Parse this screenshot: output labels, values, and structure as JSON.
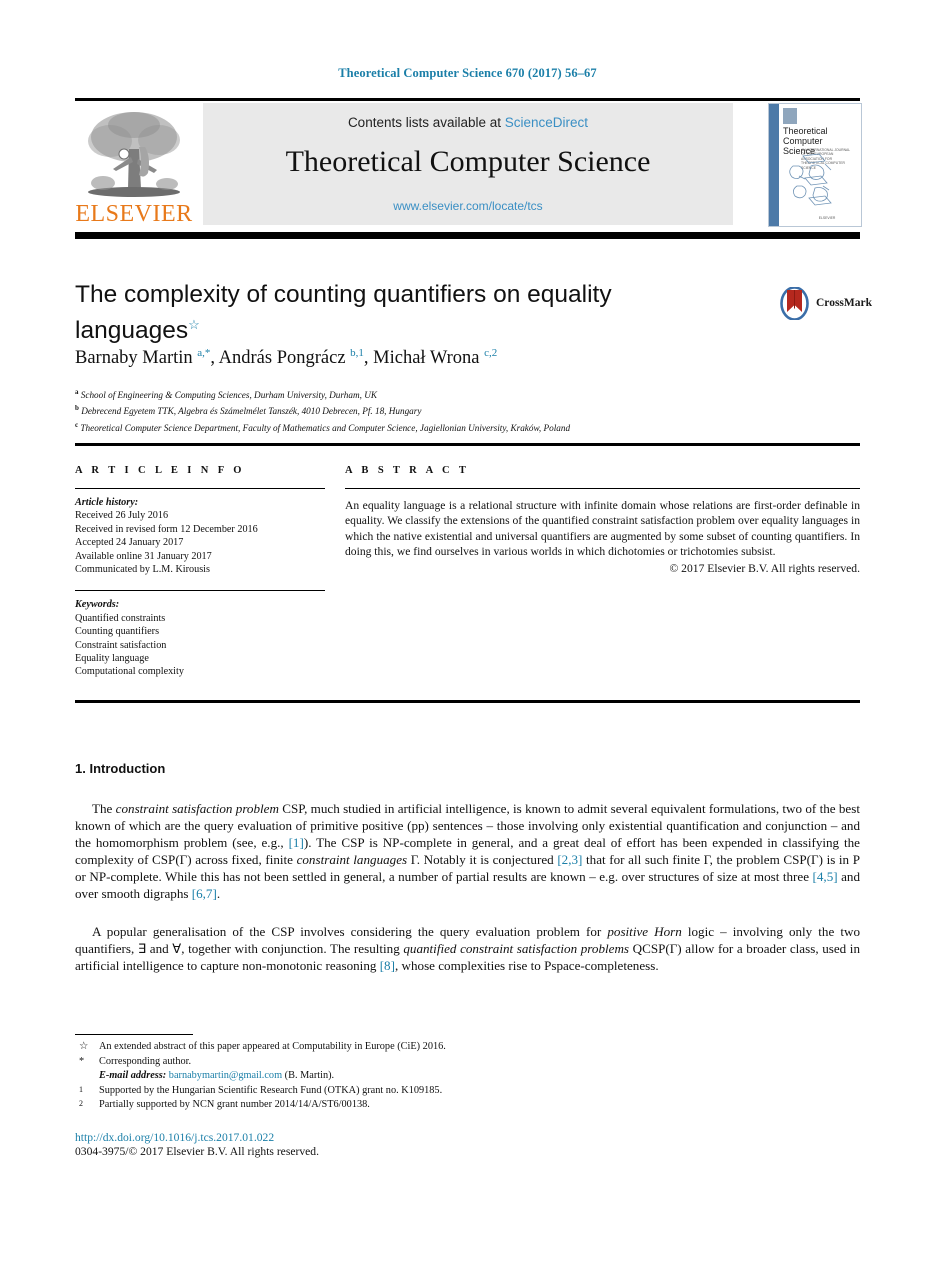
{
  "running_head": "Theoretical Computer Science 670 (2017) 56–67",
  "colors": {
    "link_teal": "#1b7fa8",
    "sciencedirect_blue": "#3a8fc4",
    "elsevier_orange": "#e8791a",
    "banner_grey": "#e9e9e9"
  },
  "masthead": {
    "publisher_wordmark": "ELSEVIER",
    "publisher_logo_alt": "elsevier-tree-logo",
    "contents_prefix": "Contents lists available at ",
    "contents_link": "ScienceDirect",
    "journal_title": "Theoretical Computer Science",
    "journal_url": "www.elsevier.com/locate/tcs",
    "cover": {
      "title_line1": "Theoretical",
      "title_line2": "Computer Science",
      "subtitle": "AN INTERNATIONAL JOURNAL OF THE EUROPEAN ASSOCIATION FOR THEORETICAL COMPUTER SCIENCE",
      "footer": "ELSEVIER"
    }
  },
  "article": {
    "title": "The complexity of counting quantifiers on equality languages",
    "title_footnote_mark": "☆",
    "authors_html": "Barnaby Martin <sup>a,*</sup>, András Pongrácz <sup>b,1</sup>, Michał Wrona <sup>c,2</sup>",
    "affiliations": [
      {
        "mark": "a",
        "text": "School of Engineering & Computing Sciences, Durham University, Durham, UK"
      },
      {
        "mark": "b",
        "text": "Debrecend Egyetem TTK, Algebra és Számelmélet Tanszék, 4010 Debrecen, Pf. 18, Hungary"
      },
      {
        "mark": "c",
        "text": "Theoretical Computer Science Department, Faculty of Mathematics and Computer Science, Jagiellonian University, Kraków, Poland"
      }
    ],
    "crossmark_label": "CrossMark"
  },
  "article_info": {
    "heading": "A R T I C L E   I N F O",
    "history_label": "Article history:",
    "history": [
      "Received 26 July 2016",
      "Received in revised form 12 December 2016",
      "Accepted 24 January 2017",
      "Available online 31 January 2017",
      "Communicated by L.M. Kirousis"
    ],
    "keywords_label": "Keywords:",
    "keywords": [
      "Quantified constraints",
      "Counting quantifiers",
      "Constraint satisfaction",
      "Equality language",
      "Computational complexity"
    ]
  },
  "abstract": {
    "heading": "A B S T R A C T",
    "text": "An equality language is a relational structure with infinite domain whose relations are first-order definable in equality. We classify the extensions of the quantified constraint satisfaction problem over equality languages in which the native existential and universal quantifiers are augmented by some subset of counting quantifiers. In doing this, we find ourselves in various worlds in which dichotomies or trichotomies subsist.",
    "copyright": "© 2017 Elsevier B.V. All rights reserved."
  },
  "body": {
    "section_heading": "1. Introduction",
    "paragraph_1_html": "The <i>constraint satisfaction problem</i> CSP, much studied in artificial intelligence, is known to admit several equivalent formulations, two of the best known of which are the query evaluation of primitive positive (pp) sentences – those involving only existential quantification and conjunction – and the homomorphism problem (see, e.g., <span class=\"ref\">[1]</span>). The CSP is NP-complete in general, and a great deal of effort has been expended in classifying the complexity of CSP(Γ) across fixed, finite <i>constraint languages</i> Γ. Notably it is conjectured <span class=\"ref\">[2,3]</span> that for all such finite Γ, the problem CSP(Γ) is in P or NP-complete. While this has not been settled in general, a number of partial results are known – e.g. over structures of size at most three <span class=\"ref\">[4,5]</span> and over smooth digraphs <span class=\"ref\">[6,7]</span>.",
    "paragraph_2_html": "A popular generalisation of the CSP involves considering the query evaluation problem for <i>positive Horn</i> logic – involving only the two quantifiers, ∃ and ∀, together with conjunction. The resulting <i>quantified constraint satisfaction problems</i> QCSP(Γ) allow for a broader class, used in artificial intelligence to capture non-monotonic reasoning <span class=\"ref\">[8]</span>, whose complexities rise to Pspace-completeness."
  },
  "footnotes": [
    {
      "mark": "☆",
      "text": "An extended abstract of this paper appeared at Computability in Europe (CiE) 2016."
    },
    {
      "mark": "*",
      "text": "Corresponding author."
    },
    {
      "mark": "1",
      "text": "Supported by the Hungarian Scientific Research Fund (OTKA) grant no. K109185."
    },
    {
      "mark": "2",
      "text": "Partially supported by NCN grant number 2014/14/A/ST6/00138."
    }
  ],
  "email_note": {
    "label": "E-mail address:",
    "address": "barnabymartin@gmail.com",
    "attribution": "(B. Martin)."
  },
  "footer": {
    "doi": "http://dx.doi.org/10.1016/j.tcs.2017.01.022",
    "issn_line": "0304-3975/© 2017 Elsevier B.V. All rights reserved."
  }
}
